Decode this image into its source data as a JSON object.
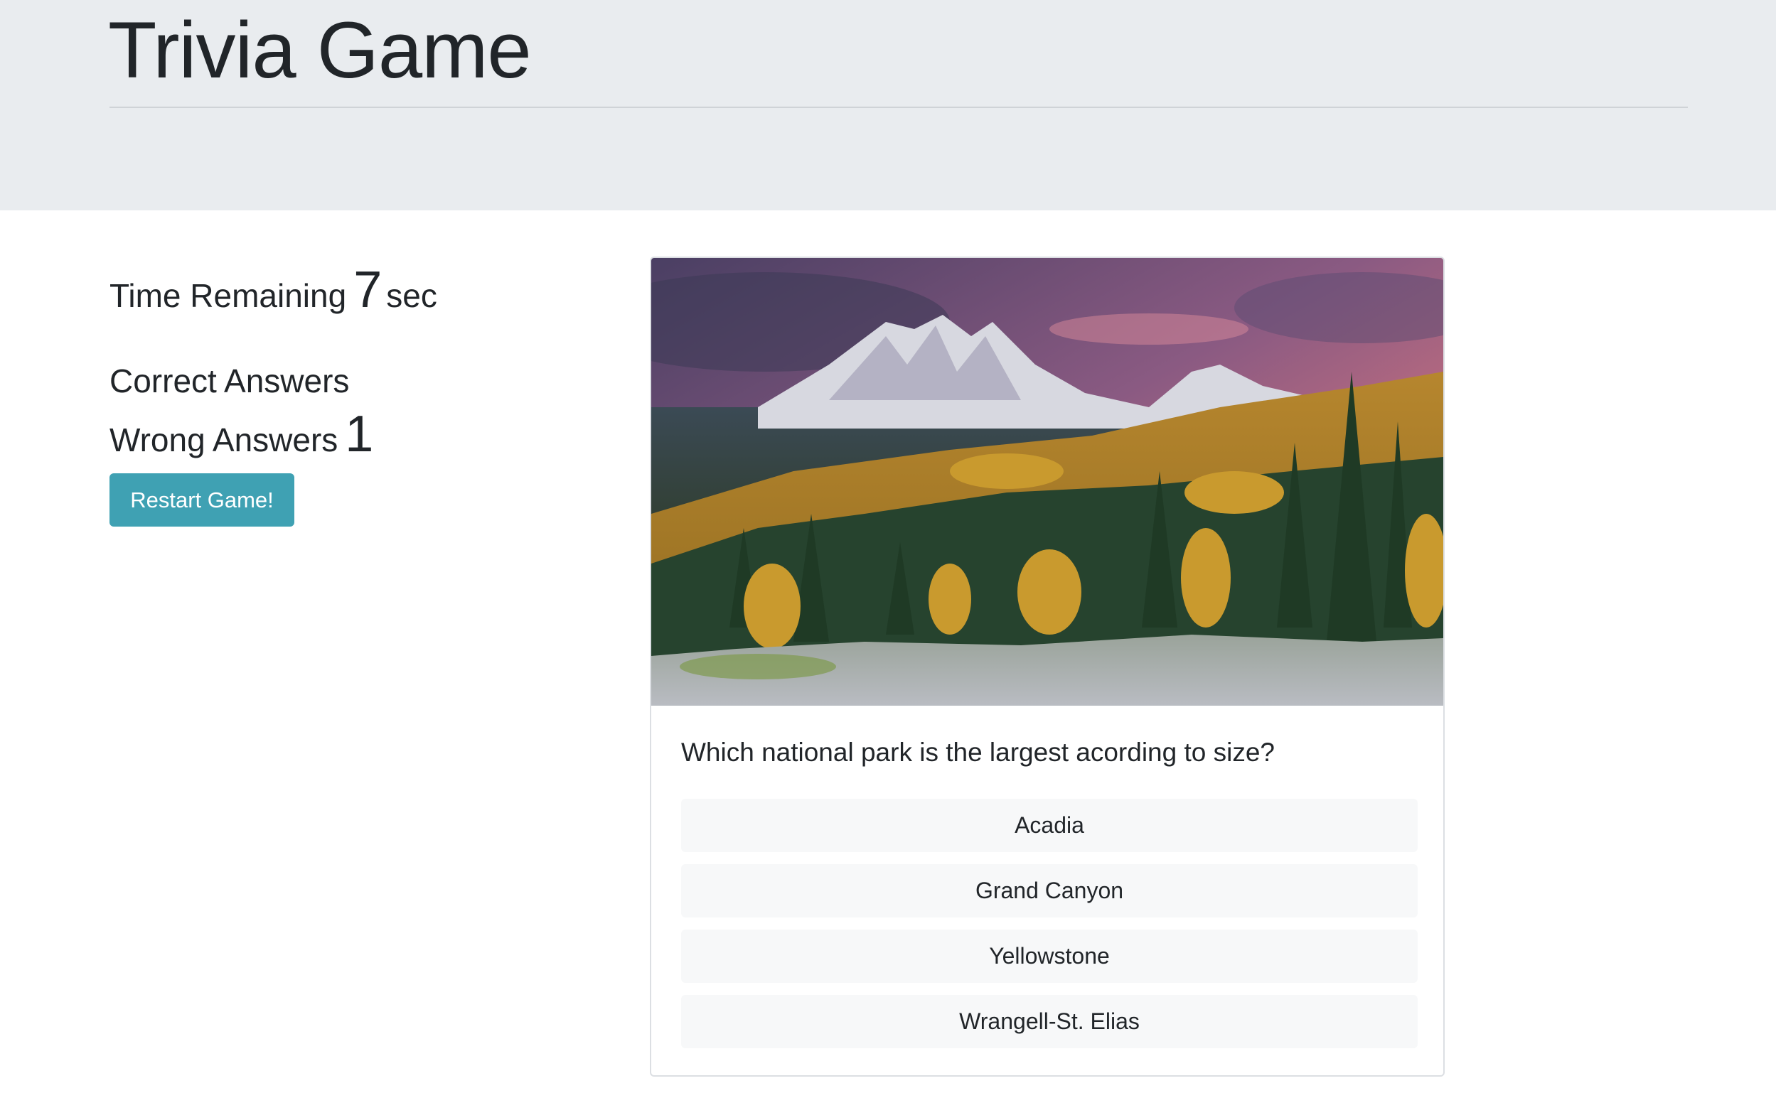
{
  "header": {
    "title": "Trivia Game"
  },
  "stats": {
    "time_label": "Time Remaining",
    "time_value": "7",
    "time_unit": "sec",
    "correct_label": "Correct Answers",
    "correct_value": "",
    "wrong_label": "Wrong Answers",
    "wrong_value": "1"
  },
  "restart_button": {
    "label": "Restart Game!",
    "color": "#3fa1b3"
  },
  "card": {
    "image_icon": "mountain-landscape-image",
    "question": "Which national park is the largest acording to size?",
    "answers": [
      "Acadia",
      "Grand Canyon",
      "Yellowstone",
      "Wrangell-St. Elias"
    ]
  },
  "colors": {
    "jumbotron_bg": "#e9ecef",
    "answer_bg": "#f7f8f9",
    "text": "#212529"
  }
}
